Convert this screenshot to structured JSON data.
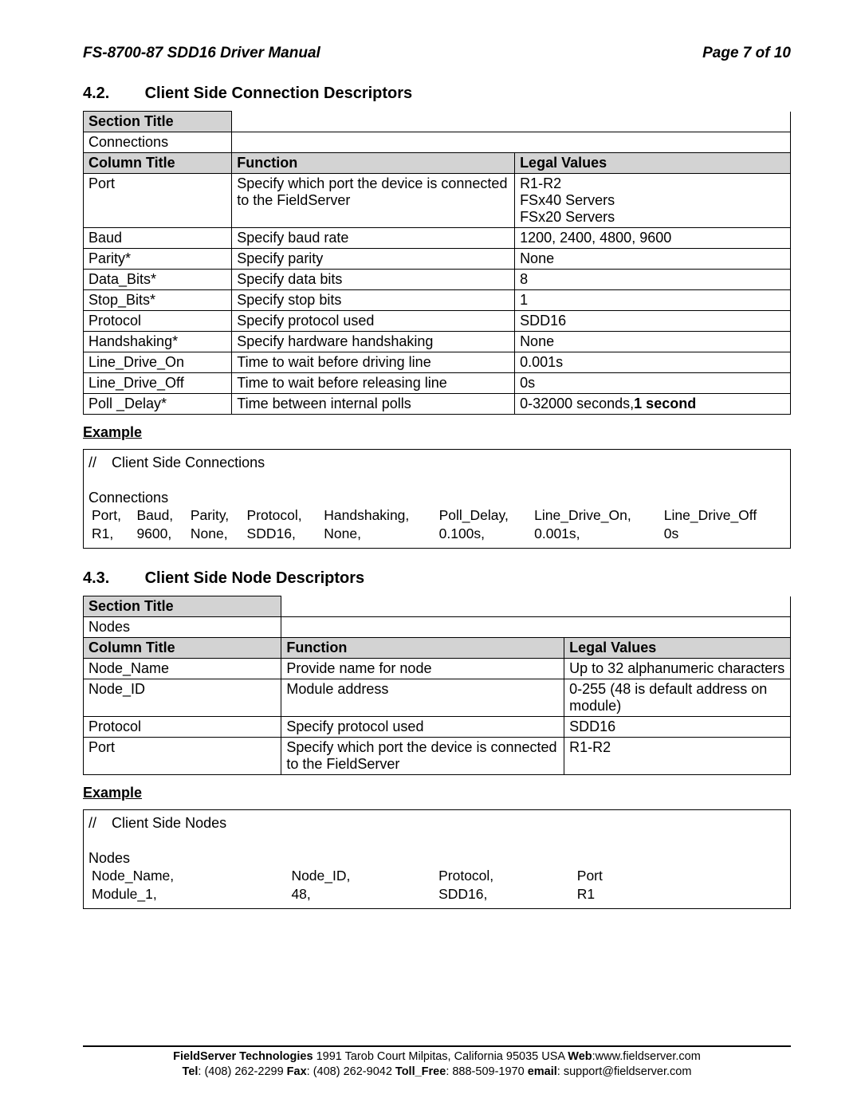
{
  "header": {
    "doc_title": "FS-8700-87 SDD16 Driver Manual",
    "page_label": "Page 7 of 10"
  },
  "sec42": {
    "number": "4.2.",
    "title": "Client Side Connection Descriptors",
    "section_title_hdr": "Section Title",
    "section_title_val": "Connections",
    "col_hdrs": {
      "col": "Column Title",
      "fun": "Function",
      "val": "Legal Values"
    },
    "rows": [
      {
        "col": "Port",
        "fun": "Specify which port the device is connected to the FieldServer",
        "val": "R1-R2\nFSx40 Servers\nFSx20 Servers",
        "bold": false
      },
      {
        "col": "Baud",
        "fun": "Specify baud rate",
        "val": "1200, 2400, 4800, 9600",
        "bold": false
      },
      {
        "col": "Parity*",
        "fun": "Specify parity",
        "val": "None",
        "bold": true
      },
      {
        "col": "Data_Bits*",
        "fun": "Specify data bits",
        "val": "8",
        "bold": true
      },
      {
        "col": "Stop_Bits*",
        "fun": "Specify stop bits",
        "val": "1",
        "bold": true
      },
      {
        "col": "Protocol",
        "fun": "Specify protocol used",
        "val": "SDD16",
        "bold": false
      },
      {
        "col": "Handshaking*",
        "fun": "Specify hardware handshaking",
        "val": "None",
        "bold": true
      },
      {
        "col": "Line_Drive_On",
        "fun": "Time to wait before driving line",
        "val": "0.001s",
        "bold": false
      },
      {
        "col": "Line_Drive_Off",
        "fun": "Time to wait before releasing line",
        "val": "0s",
        "bold": false
      },
      {
        "col": "Poll _Delay*",
        "fun": "Time between internal polls",
        "val": "0-32000 seconds,<b>1 second</b>",
        "bold": false,
        "html": true
      }
    ],
    "example_label": "Example",
    "example": {
      "comment": "Client Side Connections",
      "section": "Connections",
      "headers": [
        "Port,",
        "Baud,",
        "Parity,",
        "Protocol,",
        "Handshaking,",
        "Poll_Delay,",
        "Line_Drive_On,",
        "Line_Drive_Off"
      ],
      "values": [
        "R1,",
        "9600,",
        "None,",
        "SDD16,",
        "None,",
        "0.100s,",
        "0.001s,",
        "0s"
      ]
    }
  },
  "sec43": {
    "number": "4.3.",
    "title": "Client Side Node Descriptors",
    "section_title_hdr": "Section Title",
    "section_title_val": "Nodes",
    "col_hdrs": {
      "col": "Column Title",
      "fun": "Function",
      "val": "Legal Values"
    },
    "rows": [
      {
        "col": "Node_Name",
        "fun": "Provide name for node",
        "val": "Up to 32 alphanumeric characters"
      },
      {
        "col": "Node_ID",
        "fun": "Module address",
        "val": "0-255 (48 is default address on module)"
      },
      {
        "col": "Protocol",
        "fun": "Specify protocol used",
        "val": "SDD16"
      },
      {
        "col": "Port",
        "fun": "Specify which port the device is connected to the FieldServer",
        "val": "R1-R2"
      }
    ],
    "example_label": "Example",
    "example": {
      "comment": "Client Side Nodes",
      "section": "Nodes",
      "headers": [
        "Node_Name,",
        "Node_ID,",
        "Protocol,",
        "Port"
      ],
      "values": [
        "Module_1,",
        "48,",
        "SDD16,",
        "R1"
      ]
    }
  },
  "footer": {
    "line1_pre": "FieldServer Technologies ",
    "line1_mid": "1991 Tarob Court Milpitas, California 95035 USA  ",
    "web_lbl": "Web",
    "web_val": ":www.fieldserver.com",
    "tel_lbl": "Tel",
    "tel_val": ": (408) 262-2299  ",
    "fax_lbl": "Fax",
    "fax_val": ": (408) 262-9042  ",
    "toll_lbl": "Toll_Free",
    "toll_val": ": 888-509-1970  ",
    "email_lbl": "email",
    "email_val": ": support@fieldserver.com"
  }
}
